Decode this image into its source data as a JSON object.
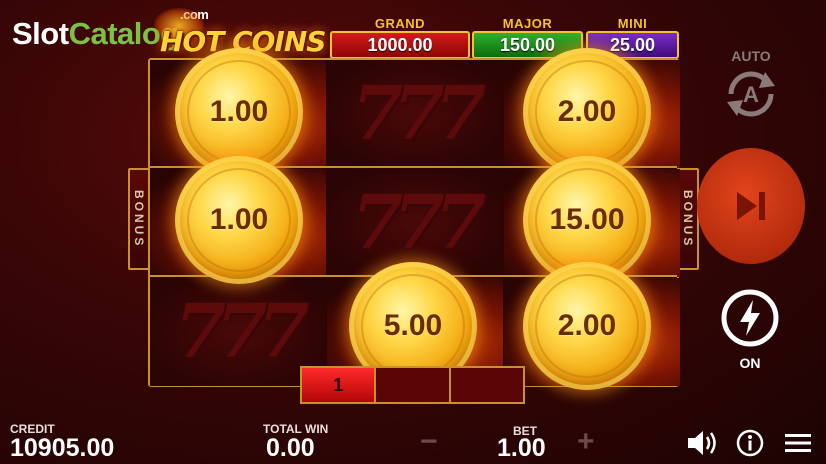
{
  "watermark": {
    "part1": "Slot",
    "part2": "Catalog",
    "suffix": ".com"
  },
  "logo": {
    "text": "HOT COINS"
  },
  "jackpots": [
    {
      "label": "GRAND",
      "value": "1000.00",
      "color": "#c41212"
    },
    {
      "label": "MAJOR",
      "value": "150.00",
      "color": "#1e9a1e"
    },
    {
      "label": "MINI",
      "value": "25.00",
      "color": "#6a22b4"
    }
  ],
  "reels": {
    "symbol_text": "777",
    "grid": [
      [
        "coin",
        "777",
        "coin"
      ],
      [
        "coin",
        "777",
        "coin"
      ],
      [
        "777",
        "coin",
        "coin"
      ]
    ],
    "coins": [
      {
        "value": "1.00",
        "reel": 1,
        "row": 1
      },
      {
        "value": "2.00",
        "reel": 3,
        "row": 1
      },
      {
        "value": "1.00",
        "reel": 1,
        "row": 2
      },
      {
        "value": "15.00",
        "reel": 3,
        "row": 2
      },
      {
        "value": "5.00",
        "reel": 2,
        "row": 3
      },
      {
        "value": "2.00",
        "reel": 3,
        "row": 3
      }
    ]
  },
  "bonus": {
    "label": "BONUS"
  },
  "progress": {
    "current": "1",
    "total_segments": 3,
    "filled": 1
  },
  "controls": {
    "auto_label": "AUTO",
    "turbo_label": "ON",
    "spin_icon": "play-skip-icon"
  },
  "footer": {
    "credit_label": "CREDIT",
    "credit_value": "10905.00",
    "total_win_label": "TOTAL WIN",
    "total_win_value": "0.00",
    "bet_label": "BET",
    "bet_value": "1.00",
    "bet_minus": "−",
    "bet_plus": "+"
  },
  "colors": {
    "frame_gold": "#c8912e",
    "spin_button": "#c8341a",
    "background": "#3a0606"
  }
}
